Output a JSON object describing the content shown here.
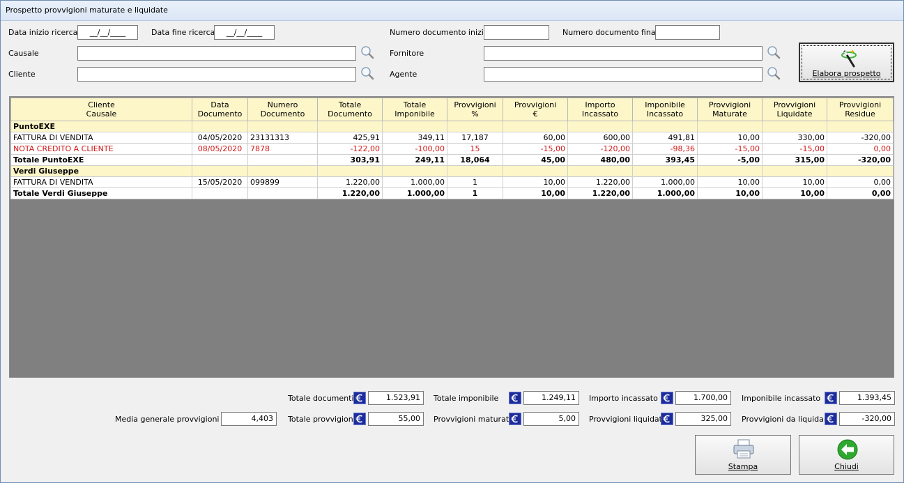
{
  "window": {
    "title": "Prospetto provvigioni maturate e liquidate"
  },
  "filters": {
    "data_inizio_label": "Data inizio ricerca",
    "data_inizio_value": "__/__/____",
    "data_fine_label": "Data fine ricerca",
    "data_fine_value": "__/__/____",
    "num_doc_iniziale_label": "Numero documento iniziale",
    "num_doc_iniziale_value": "",
    "num_doc_finale_label": "Numero documento finale",
    "num_doc_finale_value": "",
    "causale_label": "Causale",
    "causale_value": "",
    "fornitore_label": "Fornitore",
    "fornitore_value": "",
    "cliente_label": "Cliente",
    "cliente_value": "",
    "agente_label": "Agente",
    "agente_value": ""
  },
  "elabora_button": {
    "label": "Elabora prospetto"
  },
  "grid": {
    "headers": [
      [
        "Cliente",
        "Causale"
      ],
      [
        "Data",
        "Documento"
      ],
      [
        "Numero",
        "Documento"
      ],
      [
        "Totale",
        "Documento"
      ],
      [
        "Totale",
        "Imponibile"
      ],
      [
        "Provvigioni",
        "%"
      ],
      [
        "Provvigioni",
        "€"
      ],
      [
        "Importo",
        "Incassato"
      ],
      [
        "Imponibile",
        "Incassato"
      ],
      [
        "Provvigioni",
        "Maturate"
      ],
      [
        "Provvigioni",
        "Liquidate"
      ],
      [
        "Provvigioni",
        "Residue"
      ]
    ],
    "rows": [
      {
        "type": "grp",
        "cells": [
          "PuntoEXE",
          "",
          "",
          "",
          "",
          "",
          "",
          "",
          "",
          "",
          "",
          ""
        ]
      },
      {
        "type": "doc",
        "cells": [
          "FATTURA DI VENDITA",
          "04/05/2020",
          "23131313",
          "425,91",
          "349,11",
          "17,187",
          "60,00",
          "600,00",
          "491,81",
          "10,00",
          "330,00",
          "-320,00"
        ]
      },
      {
        "type": "neg",
        "cells": [
          "NOTA CREDITO A CLIENTE",
          "08/05/2020",
          "7878",
          "-122,00",
          "-100,00",
          "15",
          "-15,00",
          "-120,00",
          "-98,36",
          "-15,00",
          "-15,00",
          "0,00"
        ]
      },
      {
        "type": "tot",
        "cells": [
          "Totale PuntoEXE",
          "",
          "",
          "303,91",
          "249,11",
          "18,064",
          "45,00",
          "480,00",
          "393,45",
          "-5,00",
          "315,00",
          "-320,00"
        ]
      },
      {
        "type": "grp",
        "cells": [
          "Verdi Giuseppe",
          "",
          "",
          "",
          "",
          "",
          "",
          "",
          "",
          "",
          "",
          ""
        ]
      },
      {
        "type": "doc",
        "cells": [
          "FATTURA DI VENDITA",
          "15/05/2020",
          "099899",
          "1.220,00",
          "1.000,00",
          "1",
          "10,00",
          "1.220,00",
          "1.000,00",
          "10,00",
          "10,00",
          "0,00"
        ]
      },
      {
        "type": "tot",
        "cells": [
          "Totale Verdi Giuseppe",
          "",
          "",
          "1.220,00",
          "1.000,00",
          "1",
          "10,00",
          "1.220,00",
          "1.000,00",
          "10,00",
          "10,00",
          "0,00"
        ]
      }
    ]
  },
  "totals": {
    "totale_documenti_label": "Totale documenti",
    "totale_documenti_value": "1.523,91",
    "totale_imponibile_label": "Totale imponibile",
    "totale_imponibile_value": "1.249,11",
    "importo_incassato_label": "Importo incassato",
    "importo_incassato_value": "1.700,00",
    "imponibile_incassato_label": "Imponibile incassato",
    "imponibile_incassato_value": "1.393,45",
    "media_label": "Media generale provvigioni %",
    "media_value": "4,403",
    "totale_provvigioni_label": "Totale provvigioni",
    "totale_provvigioni_value": "55,00",
    "provvigioni_maturate_label": "Provvigioni maturate",
    "provvigioni_maturate_value": "5,00",
    "provvigioni_liquidate_label": "Provvigioni liquidate",
    "provvigioni_liquidate_value": "325,00",
    "provvigioni_da_liquidare_label": "Provvigioni da liquidare",
    "provvigioni_da_liquidare_value": "-320,00"
  },
  "buttons": {
    "stampa": "Stampa",
    "chiudi": "Chiudi"
  },
  "colors": {
    "negative": "#d01818",
    "group_bg": "#fdf6c8",
    "euro_bg": "#1c2c9c"
  }
}
